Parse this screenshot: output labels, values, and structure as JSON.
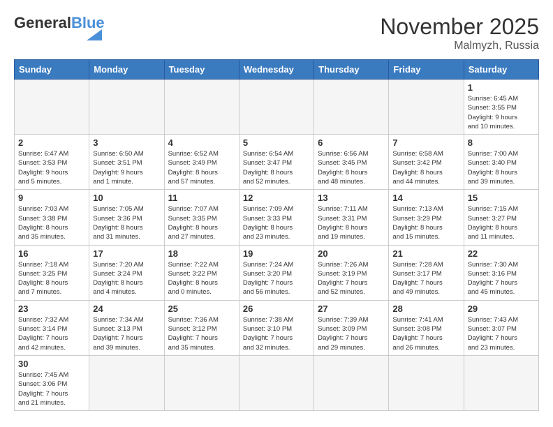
{
  "header": {
    "logo_general": "General",
    "logo_blue": "Blue",
    "month": "November 2025",
    "location": "Malmyzh, Russia"
  },
  "weekdays": [
    "Sunday",
    "Monday",
    "Tuesday",
    "Wednesday",
    "Thursday",
    "Friday",
    "Saturday"
  ],
  "days": [
    {
      "number": "",
      "info": "",
      "empty": true
    },
    {
      "number": "",
      "info": "",
      "empty": true
    },
    {
      "number": "",
      "info": "",
      "empty": true
    },
    {
      "number": "",
      "info": "",
      "empty": true
    },
    {
      "number": "",
      "info": "",
      "empty": true
    },
    {
      "number": "",
      "info": "",
      "empty": true
    },
    {
      "number": "1",
      "info": "Sunrise: 6:45 AM\nSunset: 3:55 PM\nDaylight: 9 hours\nand 10 minutes.",
      "empty": false
    }
  ],
  "week2": [
    {
      "number": "2",
      "info": "Sunrise: 6:47 AM\nSunset: 3:53 PM\nDaylight: 9 hours\nand 5 minutes.",
      "empty": false
    },
    {
      "number": "3",
      "info": "Sunrise: 6:50 AM\nSunset: 3:51 PM\nDaylight: 9 hours\nand 1 minute.",
      "empty": false
    },
    {
      "number": "4",
      "info": "Sunrise: 6:52 AM\nSunset: 3:49 PM\nDaylight: 8 hours\nand 57 minutes.",
      "empty": false
    },
    {
      "number": "5",
      "info": "Sunrise: 6:54 AM\nSunset: 3:47 PM\nDaylight: 8 hours\nand 52 minutes.",
      "empty": false
    },
    {
      "number": "6",
      "info": "Sunrise: 6:56 AM\nSunset: 3:45 PM\nDaylight: 8 hours\nand 48 minutes.",
      "empty": false
    },
    {
      "number": "7",
      "info": "Sunrise: 6:58 AM\nSunset: 3:42 PM\nDaylight: 8 hours\nand 44 minutes.",
      "empty": false
    },
    {
      "number": "8",
      "info": "Sunrise: 7:00 AM\nSunset: 3:40 PM\nDaylight: 8 hours\nand 39 minutes.",
      "empty": false
    }
  ],
  "week3": [
    {
      "number": "9",
      "info": "Sunrise: 7:03 AM\nSunset: 3:38 PM\nDaylight: 8 hours\nand 35 minutes.",
      "empty": false
    },
    {
      "number": "10",
      "info": "Sunrise: 7:05 AM\nSunset: 3:36 PM\nDaylight: 8 hours\nand 31 minutes.",
      "empty": false
    },
    {
      "number": "11",
      "info": "Sunrise: 7:07 AM\nSunset: 3:35 PM\nDaylight: 8 hours\nand 27 minutes.",
      "empty": false
    },
    {
      "number": "12",
      "info": "Sunrise: 7:09 AM\nSunset: 3:33 PM\nDaylight: 8 hours\nand 23 minutes.",
      "empty": false
    },
    {
      "number": "13",
      "info": "Sunrise: 7:11 AM\nSunset: 3:31 PM\nDaylight: 8 hours\nand 19 minutes.",
      "empty": false
    },
    {
      "number": "14",
      "info": "Sunrise: 7:13 AM\nSunset: 3:29 PM\nDaylight: 8 hours\nand 15 minutes.",
      "empty": false
    },
    {
      "number": "15",
      "info": "Sunrise: 7:15 AM\nSunset: 3:27 PM\nDaylight: 8 hours\nand 11 minutes.",
      "empty": false
    }
  ],
  "week4": [
    {
      "number": "16",
      "info": "Sunrise: 7:18 AM\nSunset: 3:25 PM\nDaylight: 8 hours\nand 7 minutes.",
      "empty": false
    },
    {
      "number": "17",
      "info": "Sunrise: 7:20 AM\nSunset: 3:24 PM\nDaylight: 8 hours\nand 4 minutes.",
      "empty": false
    },
    {
      "number": "18",
      "info": "Sunrise: 7:22 AM\nSunset: 3:22 PM\nDaylight: 8 hours\nand 0 minutes.",
      "empty": false
    },
    {
      "number": "19",
      "info": "Sunrise: 7:24 AM\nSunset: 3:20 PM\nDaylight: 7 hours\nand 56 minutes.",
      "empty": false
    },
    {
      "number": "20",
      "info": "Sunrise: 7:26 AM\nSunset: 3:19 PM\nDaylight: 7 hours\nand 52 minutes.",
      "empty": false
    },
    {
      "number": "21",
      "info": "Sunrise: 7:28 AM\nSunset: 3:17 PM\nDaylight: 7 hours\nand 49 minutes.",
      "empty": false
    },
    {
      "number": "22",
      "info": "Sunrise: 7:30 AM\nSunset: 3:16 PM\nDaylight: 7 hours\nand 45 minutes.",
      "empty": false
    }
  ],
  "week5": [
    {
      "number": "23",
      "info": "Sunrise: 7:32 AM\nSunset: 3:14 PM\nDaylight: 7 hours\nand 42 minutes.",
      "empty": false
    },
    {
      "number": "24",
      "info": "Sunrise: 7:34 AM\nSunset: 3:13 PM\nDaylight: 7 hours\nand 39 minutes.",
      "empty": false
    },
    {
      "number": "25",
      "info": "Sunrise: 7:36 AM\nSunset: 3:12 PM\nDaylight: 7 hours\nand 35 minutes.",
      "empty": false
    },
    {
      "number": "26",
      "info": "Sunrise: 7:38 AM\nSunset: 3:10 PM\nDaylight: 7 hours\nand 32 minutes.",
      "empty": false
    },
    {
      "number": "27",
      "info": "Sunrise: 7:39 AM\nSunset: 3:09 PM\nDaylight: 7 hours\nand 29 minutes.",
      "empty": false
    },
    {
      "number": "28",
      "info": "Sunrise: 7:41 AM\nSunset: 3:08 PM\nDaylight: 7 hours\nand 26 minutes.",
      "empty": false
    },
    {
      "number": "29",
      "info": "Sunrise: 7:43 AM\nSunset: 3:07 PM\nDaylight: 7 hours\nand 23 minutes.",
      "empty": false
    }
  ],
  "week6": [
    {
      "number": "30",
      "info": "Sunrise: 7:45 AM\nSunset: 3:06 PM\nDaylight: 7 hours\nand 21 minutes.",
      "empty": false
    },
    {
      "number": "",
      "info": "",
      "empty": true
    },
    {
      "number": "",
      "info": "",
      "empty": true
    },
    {
      "number": "",
      "info": "",
      "empty": true
    },
    {
      "number": "",
      "info": "",
      "empty": true
    },
    {
      "number": "",
      "info": "",
      "empty": true
    },
    {
      "number": "",
      "info": "",
      "empty": true
    }
  ]
}
